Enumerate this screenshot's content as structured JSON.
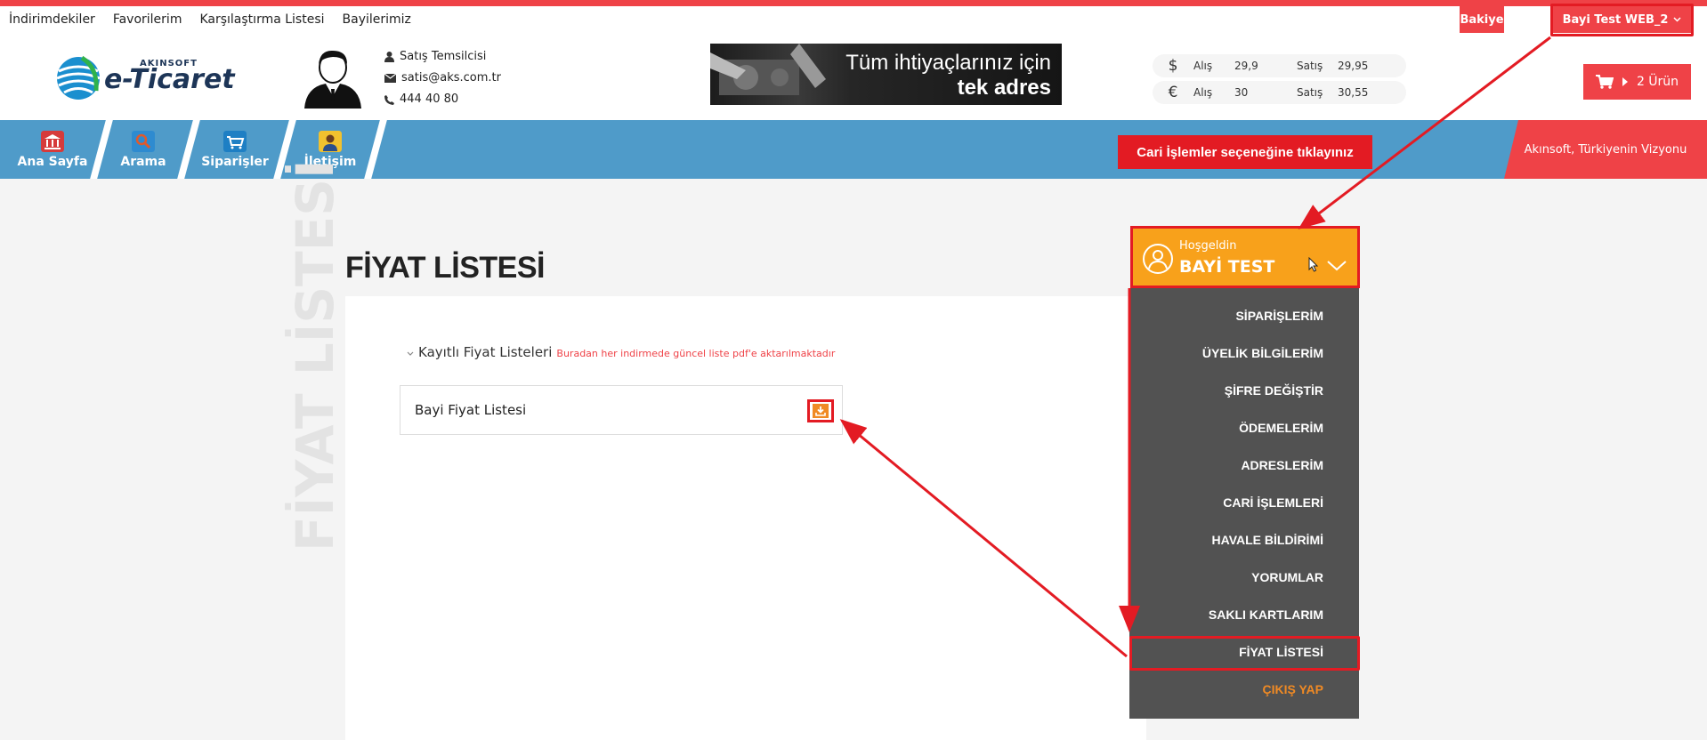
{
  "top_links": [
    "İndirimdekiler",
    "Favorilerim",
    "Karşılaştırma Listesi",
    "Bayilerimiz"
  ],
  "top_right": {
    "bakiye": "Bakiye",
    "bayi": "Bayi Test WEB_2"
  },
  "logo": {
    "small": "AKINSOFT",
    "big": "e-Ticaret"
  },
  "sales_rep": {
    "title": "Satış Temsilcisi",
    "email": "satis@aks.com.tr",
    "phone": "444 40 80"
  },
  "banner": {
    "line1": "Tüm ihtiyaçlarınız için",
    "line2": "tek adres"
  },
  "currencies": [
    {
      "symbol": "$",
      "buy_label": "Alış",
      "buy": "29,9",
      "sell_label": "Satış",
      "sell": "29,95"
    },
    {
      "symbol": "€",
      "buy_label": "Alış",
      "buy": "30",
      "sell_label": "Satış",
      "sell": "30,55"
    }
  ],
  "cart": {
    "label": "2 Ürün"
  },
  "nav": [
    "Ana Sayfa",
    "Arama",
    "Siparişler",
    "İletişim"
  ],
  "slogan": "Akınsoft, Türkiyenin Vizyonu",
  "tooltip": "Cari İşlemler seçeneğine tıklayınız",
  "page": {
    "title": "FİYAT LİSTESİ",
    "watermark": "FİYAT LİSTESİ",
    "saved_lists_label": "Kayıtlı Fiyat Listeleri",
    "saved_lists_note": "Buradan her indirmede güncel liste pdf'e aktarılmaktadır",
    "price_list_item": "Bayi Fiyat Listesi"
  },
  "user_menu": {
    "greeting": "Hoşgeldin",
    "name": "BAYİ TEST",
    "items": [
      "SİPARİŞLERİM",
      "ÜYELİK BİLGİLERİM",
      "ŞİFRE DEĞİŞTİR",
      "ÖDEMELERİM",
      "ADRESLERİM",
      "CARİ İŞLEMLERİ",
      "HAVALE BİLDİRİMİ",
      "YORUMLAR",
      "SAKLI KARTLARIM",
      "FİYAT LİSTESİ"
    ],
    "logout": "ÇIKIŞ YAP"
  },
  "colors": {
    "accent_red": "#ef4247",
    "nav_blue": "#4f9bc9",
    "user_orange": "#f8a11b",
    "menu_gray": "#525252",
    "annotation_red": "#e31b23"
  }
}
